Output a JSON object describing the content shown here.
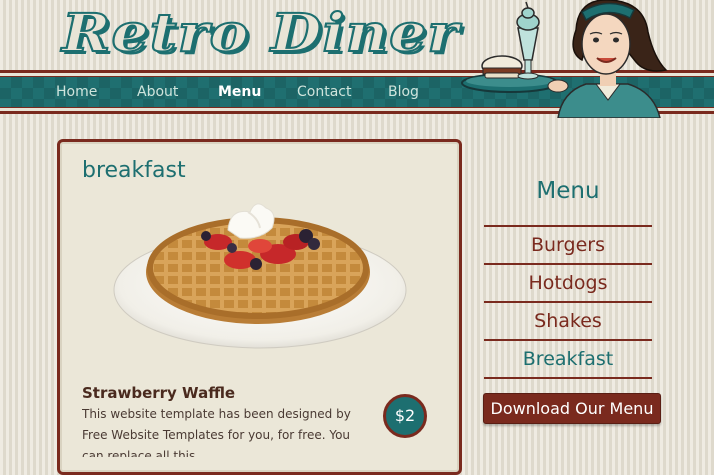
{
  "header": {
    "logo_text": "Retro Diner",
    "nav": [
      {
        "label": "Home"
      },
      {
        "label": "About"
      },
      {
        "label": "Menu"
      },
      {
        "label": "Contact"
      },
      {
        "label": "Blog"
      }
    ],
    "active_nav": "Menu"
  },
  "main": {
    "section_title": "breakfast",
    "item": {
      "name": "Strawberry Waffle",
      "description": "This website template has been designed by Free Website Templates for you, for free. You can replace all this",
      "price": "$2"
    }
  },
  "sidebar": {
    "title": "Menu",
    "items": [
      {
        "label": "Burgers"
      },
      {
        "label": "Hotdogs"
      },
      {
        "label": "Shakes"
      },
      {
        "label": "Breakfast"
      }
    ],
    "current": "Breakfast",
    "download_label": "Download Our Menu"
  },
  "colors": {
    "teal": "#1d6f70",
    "maroon": "#7a2a1e",
    "cream": "#ebe7d8"
  },
  "icons": {
    "waitress": "waitress-illustration",
    "food": "waffle-image"
  }
}
